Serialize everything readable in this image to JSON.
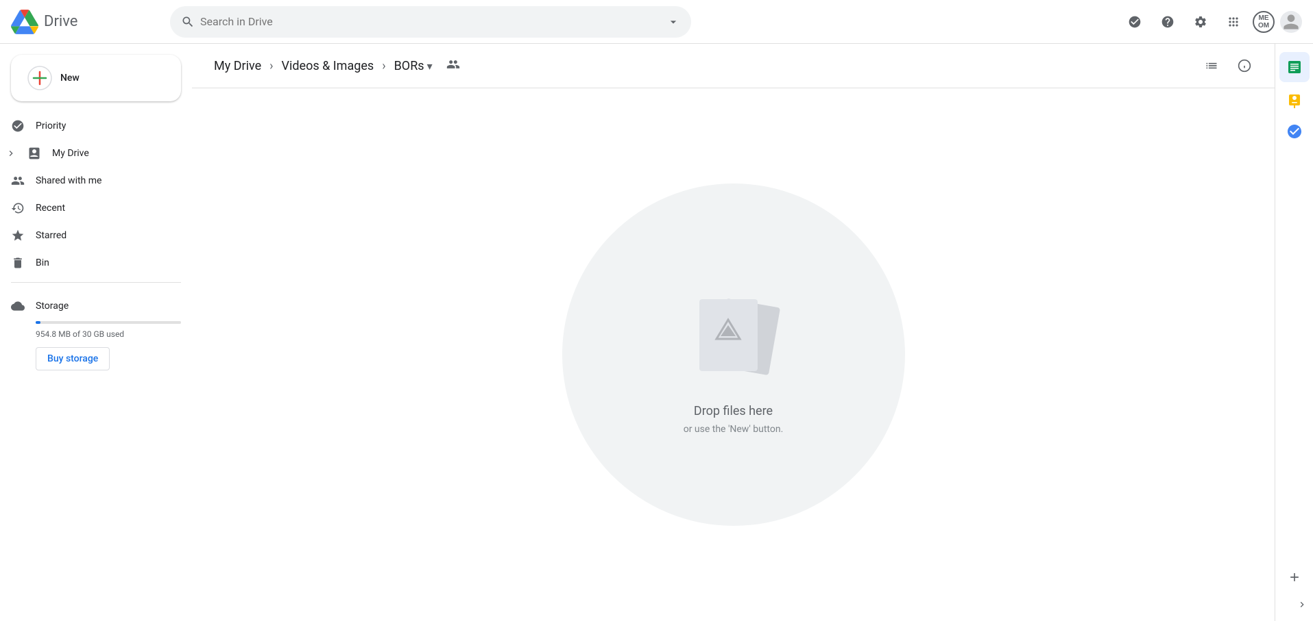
{
  "app": {
    "title": "Drive",
    "logo_alt": "Google Drive"
  },
  "topbar": {
    "search_placeholder": "Search in Drive",
    "icons": {
      "completed_tasks": "completed-tasks-icon",
      "help": "help-icon",
      "settings": "settings-icon",
      "apps": "apps-icon"
    },
    "memo_label": "ME\nOM",
    "avatar_alt": "User avatar"
  },
  "sidebar": {
    "new_button_label": "New",
    "items": [
      {
        "id": "priority",
        "label": "Priority",
        "icon": "checkbox-circle-icon"
      },
      {
        "id": "my-drive",
        "label": "My Drive",
        "icon": "drive-icon",
        "has_expand": true
      },
      {
        "id": "shared",
        "label": "Shared with me",
        "icon": "people-icon"
      },
      {
        "id": "recent",
        "label": "Recent",
        "icon": "clock-icon"
      },
      {
        "id": "starred",
        "label": "Starred",
        "icon": "star-icon"
      },
      {
        "id": "bin",
        "label": "Bin",
        "icon": "trash-icon"
      }
    ],
    "storage": {
      "label": "Storage",
      "used_text": "954.8 MB of 30 GB used",
      "used_percent": 3.2,
      "buy_button_label": "Buy storage"
    }
  },
  "breadcrumb": {
    "items": [
      {
        "label": "My Drive"
      },
      {
        "label": "Videos & Images"
      },
      {
        "label": "BORs",
        "is_current": true
      }
    ],
    "separator": "›"
  },
  "dropzone": {
    "title": "Drop files here",
    "subtitle": "or use the 'New' button."
  },
  "right_panel": {
    "buttons": [
      {
        "id": "sheets",
        "icon": "sheets-icon",
        "active": true
      },
      {
        "id": "keep",
        "icon": "keep-icon"
      },
      {
        "id": "tasks",
        "icon": "tasks-icon"
      },
      {
        "id": "add",
        "icon": "add-icon"
      }
    ],
    "expand_label": "›"
  }
}
